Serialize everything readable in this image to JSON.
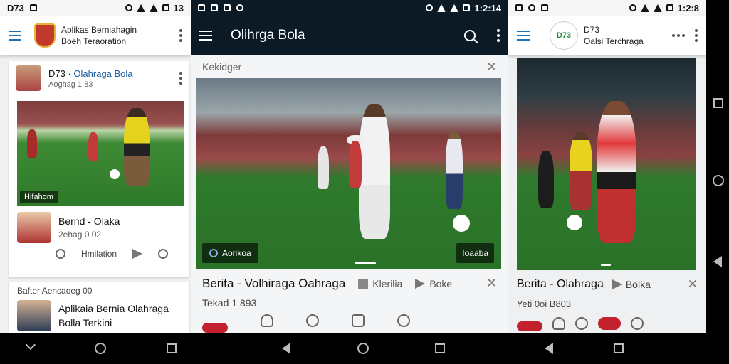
{
  "panel1": {
    "status_time": "D73",
    "status_right": "13",
    "app_title": "Aplikas Berniahagin",
    "app_subtitle": "Boeh Teraoration",
    "card1": {
      "name_prefix": "D73 ·",
      "name_highlight": "Olahraga Bola",
      "meta": "Aoghag 1 83",
      "image_badge": "Hifahom",
      "row_title": "Bernd - Olaka",
      "row_meta": "2ehag 0 02",
      "action_label": "Hmilation"
    },
    "card2": {
      "label": "Bafter Aencaoeg 00",
      "title_line1": "Aplikaia Bernia Olahraga",
      "title_line2": "Bolla Terkini"
    }
  },
  "panel2": {
    "status_time": "1:2:14",
    "app_title": "Olihrga Bola",
    "top_label": "Kekidger",
    "hero_badge_left": "Aorikoa",
    "hero_badge_right": "Ioaaba",
    "title": "Berita - Volhiraga Oahraga",
    "meta1": "Klerilia",
    "meta2": "Boke",
    "sub": "Tekad 1 893"
  },
  "panel3": {
    "status_right": "1:2:8",
    "logo_text": "D73",
    "app_title": "D73",
    "app_subtitle": "Oalsi Terchraga",
    "title": "Berita - Olahraga",
    "meta": "Bolka",
    "sub": "Yeti 0oi B803"
  },
  "colors": {
    "accent_blue": "#1a73b8",
    "dark_header": "#0c1a26",
    "brand_red": "#c4212e"
  }
}
